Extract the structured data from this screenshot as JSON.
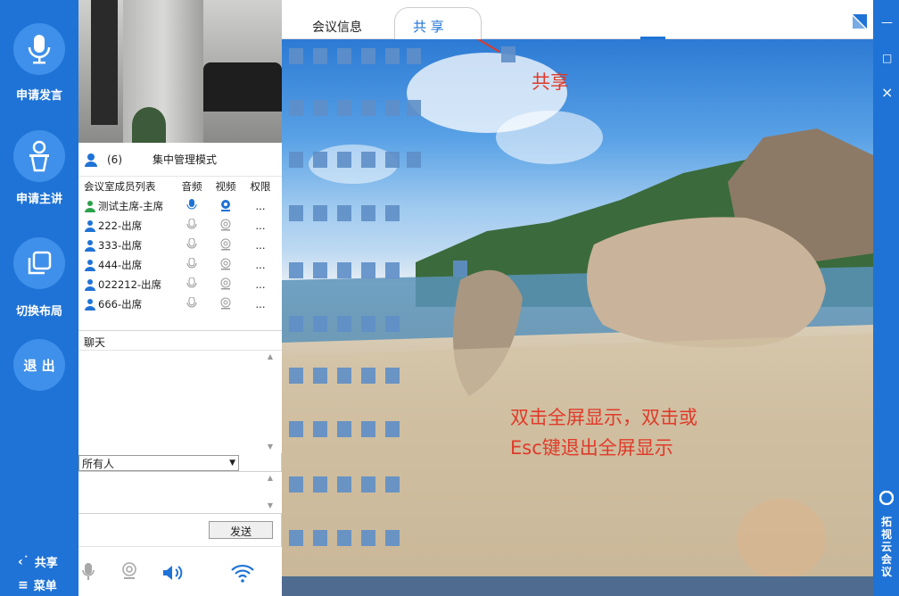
{
  "left_sidebar": {
    "request_speak": "申请发言",
    "request_host": "申请主讲",
    "switch_layout": "切换布局",
    "quit": "退 出",
    "share": "共享",
    "menu": "菜单"
  },
  "members": {
    "count": "(6)",
    "mode": "集中管理模式",
    "header": {
      "name": "会议室成员列表",
      "audio": "音频",
      "video": "视频",
      "perm": "权限"
    },
    "rows": [
      {
        "name": "测试主席-主席",
        "perm": "..."
      },
      {
        "name": "222-出席",
        "perm": "..."
      },
      {
        "name": "333-出席",
        "perm": "..."
      },
      {
        "name": "444-出席",
        "perm": "..."
      },
      {
        "name": "022212-出席",
        "perm": "..."
      },
      {
        "name": "666-出席",
        "perm": "..."
      }
    ]
  },
  "chat": {
    "label": "聊天",
    "recipient": "所有人",
    "send": "发送"
  },
  "tabs": {
    "info": "会议信息",
    "share": "共 享"
  },
  "annotations": {
    "share": "共享",
    "fullscreen_line1": "双击全屏显示，双击或",
    "fullscreen_line2": "Esc键退出全屏显示"
  },
  "right_bar": {
    "minimize": "—",
    "maximize": "□",
    "close": "×",
    "brand": "拓视云会议"
  },
  "colors": {
    "sidebar": "#1f73d6",
    "button": "#3f90ea",
    "annotation": "#e03a2a"
  }
}
